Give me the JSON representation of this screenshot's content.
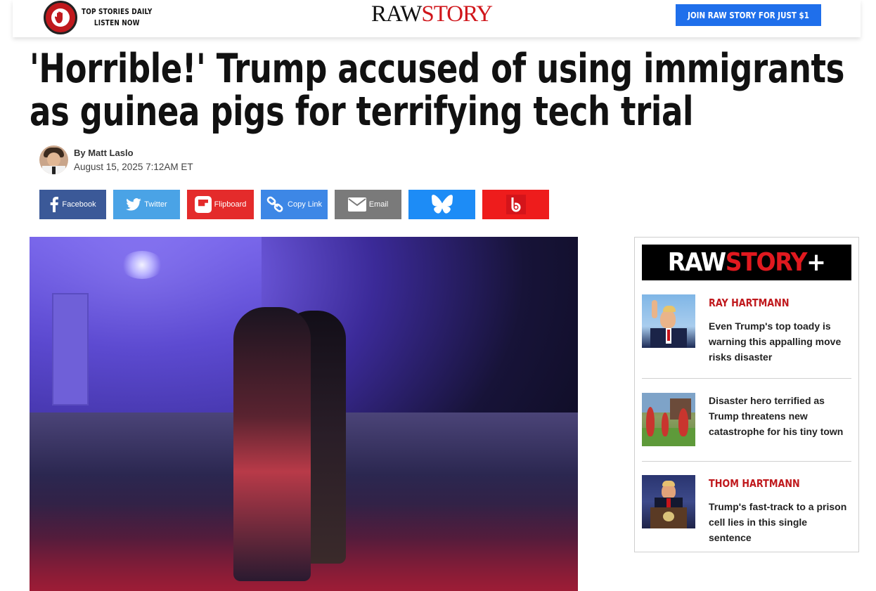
{
  "header": {
    "podcast_line1": "TOP STORIES DAILY",
    "podcast_line2": "LISTEN NOW",
    "brand_raw": "RAW",
    "brand_story": "STORY",
    "join_label": "JOIN RAW STORY FOR JUST $1"
  },
  "article": {
    "headline_line1": "'Horrible!' Trump accused of using immigrants",
    "headline_line2": "as guinea pigs for terrifying tech trial",
    "author": "By Matt Laslo",
    "date": "August 15, 2025 7:12AM ET"
  },
  "share": {
    "facebook": "Facebook",
    "twitter": "Twitter",
    "flipboard": "Flipboard",
    "copy_link": "Copy Link",
    "email": "Email"
  },
  "sidebar": {
    "banner_raw": "RAW",
    "banner_story": "STORY",
    "banner_plus": "+",
    "items": [
      {
        "kicker": "RAY HARTMANN",
        "title": "Even Trump's top toady is warning this appalling move risks disaster"
      },
      {
        "kicker": "",
        "title": "Disaster hero terrified as Trump threatens new catastrophe for his tiny town"
      },
      {
        "kicker": "THOM HARTMANN",
        "title": "Trump's fast-track to a prison cell lies in this single sentence"
      }
    ]
  },
  "colors": {
    "brand_red": "#d0161b",
    "join_blue": "#1f6feb",
    "facebook": "#3b5998",
    "twitter": "#4aa3e6",
    "flipboard": "#e42b2b",
    "copy_link": "#3d87e6",
    "email": "#7a7a7a",
    "bluesky": "#1d8cf6",
    "beehiiv": "#ee1c1c"
  }
}
